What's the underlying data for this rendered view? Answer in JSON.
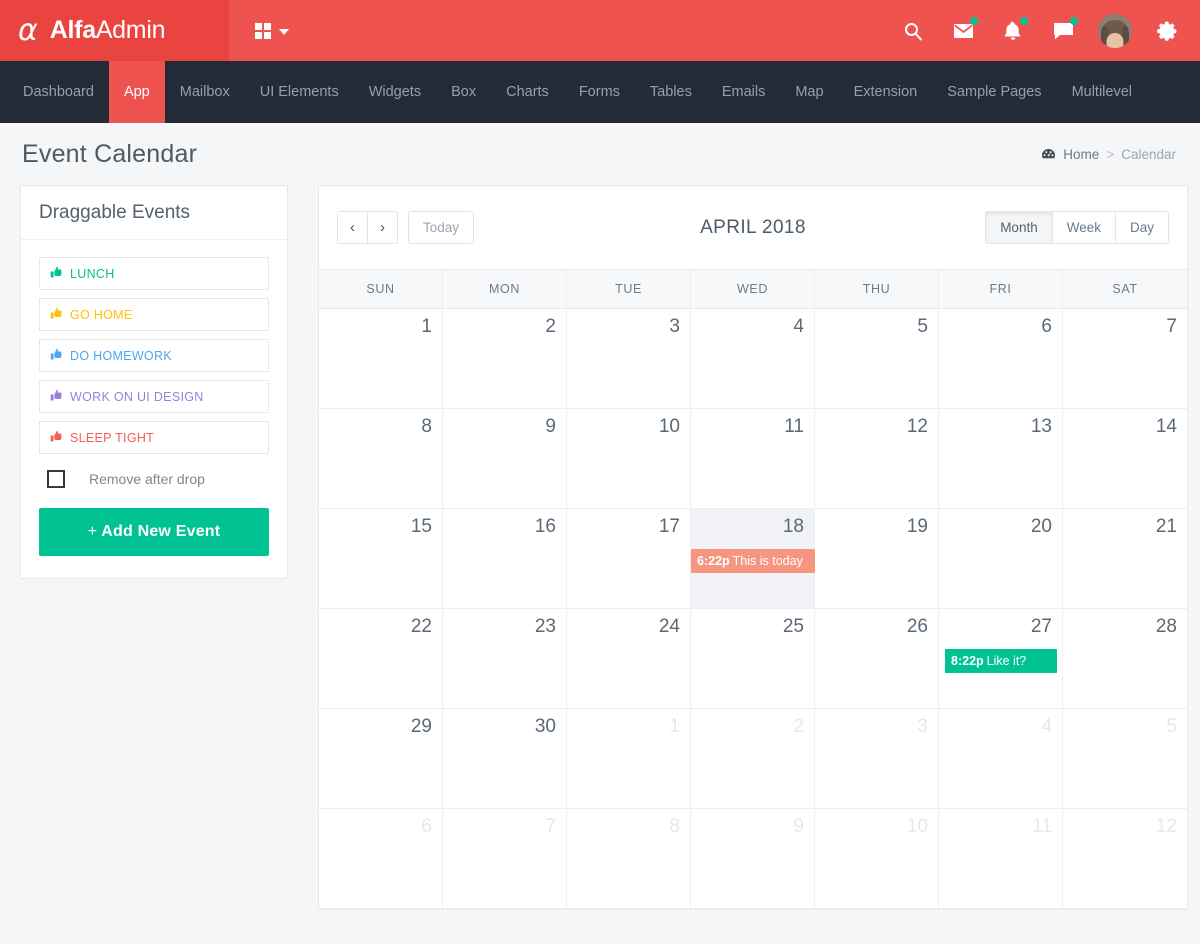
{
  "brand": {
    "logo_glyph": "α",
    "name_bold": "Alfa",
    "name_light": "Admin"
  },
  "topbar": {
    "grid_icon": "grid-apps-icon",
    "caret_icon": "chevron-down-icon",
    "icons": [
      {
        "name": "search-icon",
        "badge": false
      },
      {
        "name": "mail-icon",
        "badge": true
      },
      {
        "name": "bell-icon",
        "badge": true
      },
      {
        "name": "chat-icon",
        "badge": true
      }
    ],
    "avatar": "user-avatar",
    "settings_icon": "gear-icon",
    "bg_color": "#ef5350",
    "brand_bg_color": "#e94440",
    "badge_color": "#00c292"
  },
  "nav": {
    "bg_color": "#232b38",
    "active_color": "#ef5350",
    "items": [
      {
        "label": "Dashboard",
        "active": false
      },
      {
        "label": "App",
        "active": true
      },
      {
        "label": "Mailbox",
        "active": false
      },
      {
        "label": "UI Elements",
        "active": false
      },
      {
        "label": "Widgets",
        "active": false
      },
      {
        "label": "Box",
        "active": false
      },
      {
        "label": "Charts",
        "active": false
      },
      {
        "label": "Forms",
        "active": false
      },
      {
        "label": "Tables",
        "active": false
      },
      {
        "label": "Emails",
        "active": false
      },
      {
        "label": "Map",
        "active": false
      },
      {
        "label": "Extension",
        "active": false
      },
      {
        "label": "Sample Pages",
        "active": false
      },
      {
        "label": "Multilevel",
        "active": false
      }
    ]
  },
  "page": {
    "title": "Event Calendar",
    "breadcrumb": {
      "icon": "dashboard-icon",
      "home": "Home",
      "separator": ">",
      "current": "Calendar"
    }
  },
  "sidebar": {
    "title": "Draggable Events",
    "events": [
      {
        "label": "LUNCH",
        "color": "#00c292",
        "icon": "thumbs-up-icon"
      },
      {
        "label": "GO HOME",
        "color": "#fec107",
        "icon": "thumbs-up-icon"
      },
      {
        "label": "DO HOMEWORK",
        "color": "#4aa7f5",
        "icon": "thumbs-up-icon"
      },
      {
        "label": "WORK ON UI DESIGN",
        "color": "#9a7ede",
        "icon": "thumbs-up-icon"
      },
      {
        "label": "SLEEP TIGHT",
        "color": "#fb5b5b",
        "icon": "thumbs-up-icon"
      }
    ],
    "remove_after_drop": {
      "label": "Remove after drop",
      "checked": false
    },
    "add_button": {
      "plus": "+",
      "label": "Add New Event",
      "color": "#00c292"
    }
  },
  "calendar": {
    "toolbar": {
      "prev": "‹",
      "next": "›",
      "today": "Today",
      "title": "APRIL 2018",
      "views": [
        {
          "label": "Month",
          "active": true
        },
        {
          "label": "Week",
          "active": false
        },
        {
          "label": "Day",
          "active": false
        }
      ]
    },
    "weekdays": [
      "SUN",
      "MON",
      "TUE",
      "WED",
      "THU",
      "FRI",
      "SAT"
    ],
    "weeks": [
      [
        {
          "day": "1",
          "other": false,
          "today": false
        },
        {
          "day": "2",
          "other": false,
          "today": false
        },
        {
          "day": "3",
          "other": false,
          "today": false
        },
        {
          "day": "4",
          "other": false,
          "today": false
        },
        {
          "day": "5",
          "other": false,
          "today": false
        },
        {
          "day": "6",
          "other": false,
          "today": false
        },
        {
          "day": "7",
          "other": false,
          "today": false
        }
      ],
      [
        {
          "day": "8",
          "other": false,
          "today": false
        },
        {
          "day": "9",
          "other": false,
          "today": false
        },
        {
          "day": "10",
          "other": false,
          "today": false
        },
        {
          "day": "11",
          "other": false,
          "today": false
        },
        {
          "day": "12",
          "other": false,
          "today": false
        },
        {
          "day": "13",
          "other": false,
          "today": false
        },
        {
          "day": "14",
          "other": false,
          "today": false
        }
      ],
      [
        {
          "day": "15",
          "other": false,
          "today": false
        },
        {
          "day": "16",
          "other": false,
          "today": false
        },
        {
          "day": "17",
          "other": false,
          "today": false
        },
        {
          "day": "18",
          "other": false,
          "today": true,
          "event": {
            "time": "6:22p",
            "title": "This is today",
            "color": "orange"
          }
        },
        {
          "day": "19",
          "other": false,
          "today": false
        },
        {
          "day": "20",
          "other": false,
          "today": false
        },
        {
          "day": "21",
          "other": false,
          "today": false
        }
      ],
      [
        {
          "day": "22",
          "other": false,
          "today": false
        },
        {
          "day": "23",
          "other": false,
          "today": false
        },
        {
          "day": "24",
          "other": false,
          "today": false
        },
        {
          "day": "25",
          "other": false,
          "today": false
        },
        {
          "day": "26",
          "other": false,
          "today": false
        },
        {
          "day": "27",
          "other": false,
          "today": false,
          "event": {
            "time": "8:22p",
            "title": "Like it?",
            "color": "green"
          }
        },
        {
          "day": "28",
          "other": false,
          "today": false
        }
      ],
      [
        {
          "day": "29",
          "other": false,
          "today": false
        },
        {
          "day": "30",
          "other": false,
          "today": false
        },
        {
          "day": "1",
          "other": true,
          "today": false
        },
        {
          "day": "2",
          "other": true,
          "today": false
        },
        {
          "day": "3",
          "other": true,
          "today": false
        },
        {
          "day": "4",
          "other": true,
          "today": false
        },
        {
          "day": "5",
          "other": true,
          "today": false
        }
      ],
      [
        {
          "day": "6",
          "other": true,
          "today": false
        },
        {
          "day": "7",
          "other": true,
          "today": false
        },
        {
          "day": "8",
          "other": true,
          "today": false
        },
        {
          "day": "9",
          "other": true,
          "today": false
        },
        {
          "day": "10",
          "other": true,
          "today": false
        },
        {
          "day": "11",
          "other": true,
          "today": false
        },
        {
          "day": "12",
          "other": true,
          "today": false
        }
      ]
    ]
  }
}
